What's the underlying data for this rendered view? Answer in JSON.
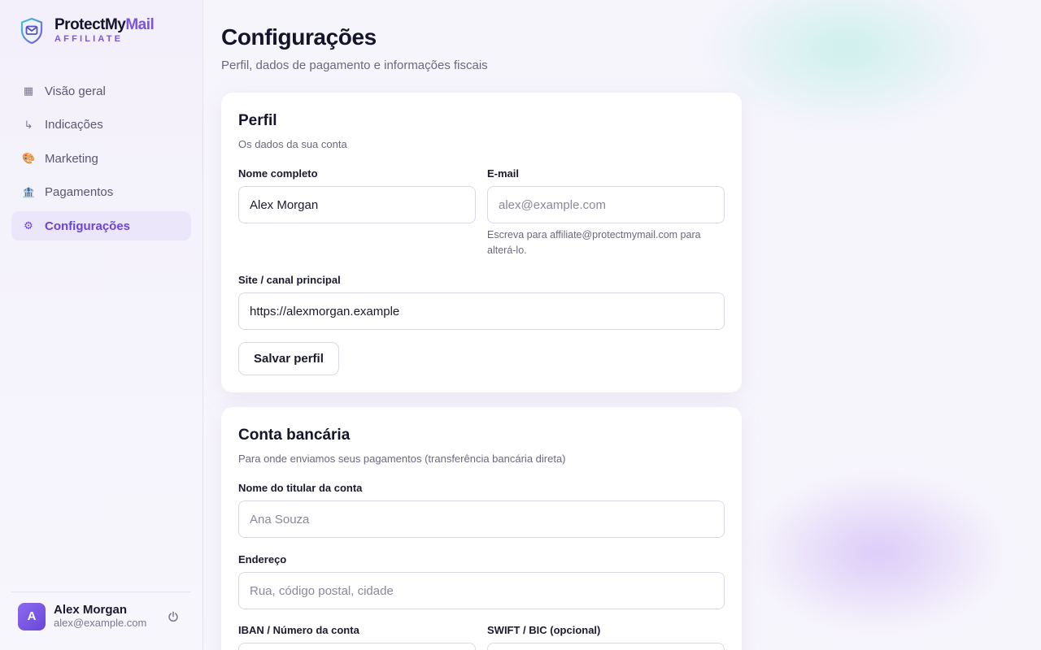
{
  "brand": {
    "name_main": "ProtectMy",
    "name_accent": "Mail",
    "sub": "AFFILIATE",
    "accent_color": "#7b55e0"
  },
  "nav": {
    "items": [
      {
        "icon": "▦",
        "label": "Visão geral"
      },
      {
        "icon": "↳",
        "label": "Indicações"
      },
      {
        "icon": "🎨",
        "label": "Marketing"
      },
      {
        "icon": "🏦",
        "label": "Pagamentos"
      },
      {
        "icon": "⚙",
        "label": "Configurações",
        "active": true
      }
    ]
  },
  "user": {
    "initial": "A",
    "name": "Alex Morgan",
    "email": "alex@example.com"
  },
  "page": {
    "title": "Configurações",
    "subtitle": "Perfil, dados de pagamento e informações fiscais"
  },
  "profile": {
    "title": "Perfil",
    "desc": "Os dados da sua conta",
    "name_label": "Nome completo",
    "name_value": "Alex Morgan",
    "email_label": "E-mail",
    "email_placeholder": "alex@example.com",
    "email_hint": "Escreva para affiliate@protectmymail.com para alterá-lo.",
    "site_label": "Site / canal principal",
    "site_value": "https://alexmorgan.example",
    "save_label": "Salvar perfil"
  },
  "bank": {
    "title": "Conta bancária",
    "desc": "Para onde enviamos seus pagamentos (transferência bancária direta)",
    "holder_label": "Nome do titular da conta",
    "holder_placeholder": "Ana Souza",
    "address_label": "Endereço",
    "address_placeholder": "Rua, código postal, cidade",
    "iban_label": "IBAN / Número da conta",
    "swift_label": "SWIFT / BIC (opcional)"
  }
}
